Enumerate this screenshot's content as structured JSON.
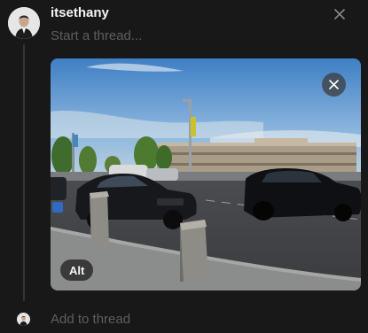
{
  "post": {
    "username": "itsethany",
    "placeholder": "Start a thread...",
    "alt_label": "Alt"
  },
  "footer": {
    "add_thread": "Add to thread"
  },
  "icons": {
    "close": "close-icon",
    "remove_media": "x-circle-icon"
  },
  "colors": {
    "background": "#181818",
    "primary_text": "#f3f5f7",
    "secondary_text": "#5e5e5e",
    "thread_line": "#333638"
  }
}
